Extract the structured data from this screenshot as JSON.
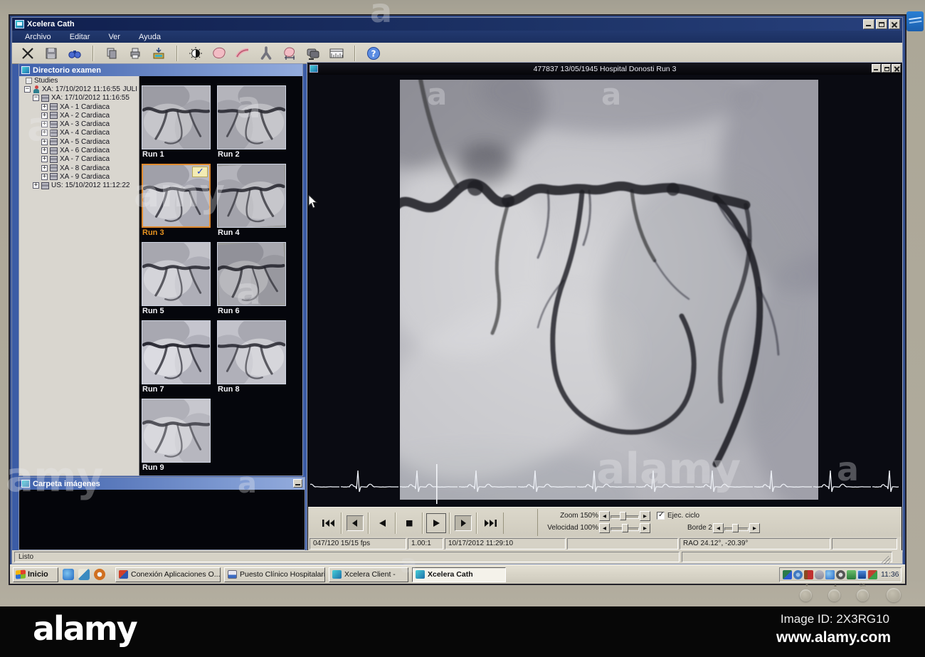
{
  "window": {
    "title": "Xcelera Cath"
  },
  "menu": {
    "items": [
      "Archivo",
      "Editar",
      "Ver",
      "Ayuda"
    ]
  },
  "toolbar": {
    "icons": [
      "delete",
      "save",
      "search",
      "copy",
      "print",
      "export",
      "contrast",
      "heart-analysis",
      "vessel-analysis",
      "bifurcation",
      "ventricle-measure",
      "cine-stack",
      "calibration",
      "help"
    ]
  },
  "directory_panel": {
    "title": "Directorio examen",
    "tree": {
      "root": "Studies",
      "study": "XA: 17/10/2012 11:16:55",
      "study_patient": "JULI",
      "series_group": "XA: 17/10/2012 11:16:55",
      "series": [
        "XA - 1 Cardiaca",
        "XA - 2 Cardiaca",
        "XA - 3 Cardiaca",
        "XA - 4 Cardiaca",
        "XA - 5 Cardiaca",
        "XA - 6 Cardiaca",
        "XA - 7 Cardiaca",
        "XA - 8 Cardiaca",
        "XA - 9 Cardiaca"
      ],
      "other_study": "US: 15/10/2012 11:12:22"
    }
  },
  "thumbnails": {
    "runs": [
      {
        "label": "Run 1",
        "selected": false
      },
      {
        "label": "Run 2",
        "selected": false
      },
      {
        "label": "Run 3",
        "selected": true
      },
      {
        "label": "Run 4",
        "selected": false
      },
      {
        "label": "Run 5",
        "selected": false
      },
      {
        "label": "Run 6",
        "selected": false
      },
      {
        "label": "Run 7",
        "selected": false
      },
      {
        "label": "Run 8",
        "selected": false
      },
      {
        "label": "Run 9",
        "selected": false
      }
    ]
  },
  "images_panel": {
    "title": "Carpeta imágenes"
  },
  "viewer": {
    "title": "477837 13/05/1945 Hospital Donosti Run 3",
    "controls": {
      "zoom_label": "Zoom 150%",
      "velocidad_label": "Velocidad 100%",
      "ejec_ciclo_label": "Ejec. ciclo",
      "ejec_ciclo_checked": true,
      "borde_label": "Borde 2"
    },
    "status": [
      "047/120  15/15 fps",
      "1.00:1",
      "10/17/2012 11:29:10",
      "",
      "RAO 24.12°, -20.39°",
      ""
    ]
  },
  "statusbar": {
    "text": "Listo"
  },
  "taskbar": {
    "start": "Inicio",
    "tasks": [
      "Conexión Aplicaciones O...",
      "Puesto Clínico Hospitalari...",
      "Xcelera Client -",
      "Xcelera Cath"
    ],
    "tray_icons": [
      "remote-session",
      "settings",
      "volume",
      "antivirus",
      "messenger",
      "update",
      "network",
      "display",
      "dual-monitor"
    ],
    "clock": "11:36"
  },
  "watermark": {
    "logo": "alamy",
    "image_id": "Image ID: 2X3RG10",
    "url": "www.alamy.com",
    "ghost_a": "a",
    "ghost_amy": "amy",
    "ghost_alamy": "alamy"
  },
  "colors": {
    "selection_orange": "#e08a2e",
    "titlebar_navy": "#16295e",
    "panel_blue": "#4a6ab2",
    "chrome_gray": "#d6d2c6"
  }
}
